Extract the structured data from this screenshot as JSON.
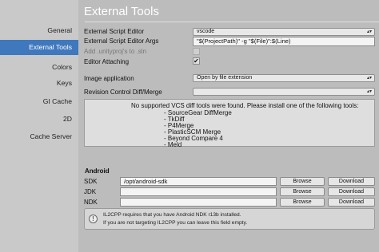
{
  "sidebar": {
    "items": [
      {
        "label": "General"
      },
      {
        "label": "External Tools"
      },
      {
        "label": "Colors"
      },
      {
        "label": "Keys"
      },
      {
        "label": "GI Cache"
      },
      {
        "label": "2D"
      },
      {
        "label": "Cache Server"
      }
    ],
    "active_index": 1
  },
  "main": {
    "title": "External Tools",
    "script_editor": {
      "label": "External Script Editor",
      "value": "vscode"
    },
    "script_editor_args": {
      "label": "External Script Editor Args",
      "value": "\"$(ProjectPath)\" -g \"$(File)\":$(Line)"
    },
    "add_unityproj": {
      "label": "Add .unityproj's to .sln",
      "checked": false
    },
    "editor_attaching": {
      "label": "Editor Attaching",
      "checked": true,
      "mark": "✔"
    },
    "image_application": {
      "label": "Image application",
      "value": "Open by file extension"
    },
    "revision_control": {
      "label": "Revision Control Diff/Merge",
      "value": ""
    },
    "vcs_info": {
      "message": "No supported VCS diff tools were found. Please install one of the following tools:",
      "tools": [
        "- SourceGear DiffMerge",
        "- TkDiff",
        "- P4Merge",
        "- PlasticSCM Merge",
        "- Beyond Compare 4",
        "- Meld"
      ]
    },
    "android": {
      "section_title": "Android",
      "rows": [
        {
          "label": "SDK",
          "value": "/opt/android-sdk"
        },
        {
          "label": "JDK",
          "value": ""
        },
        {
          "label": "NDK",
          "value": ""
        }
      ],
      "browse_label": "Browse",
      "download_label": "Download",
      "warning_icon": "!",
      "warning_lines": [
        "IL2CPP requires that you have Android NDK r13b installed.",
        "If you are not targeting IL2CPP you can leave this field empty."
      ]
    }
  }
}
